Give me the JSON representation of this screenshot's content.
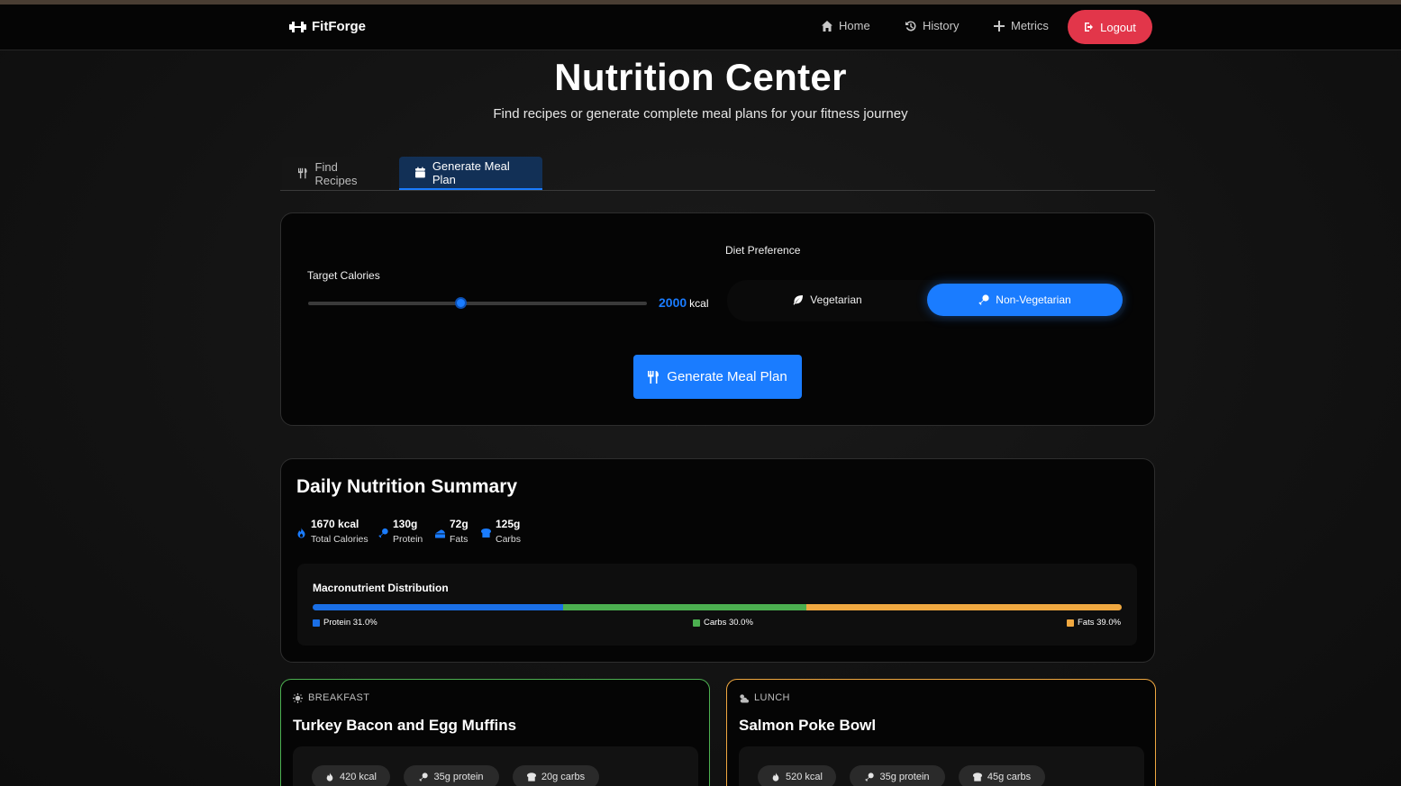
{
  "app": {
    "brand": "FitForge"
  },
  "nav": {
    "home": "Home",
    "history": "History",
    "metrics": "Metrics",
    "logout": "Logout"
  },
  "page": {
    "title": "Nutrition Center",
    "subtitle": "Find recipes or generate complete meal plans for your fitness journey"
  },
  "tabs": [
    {
      "label": "Find Recipes"
    },
    {
      "label": "Generate Meal Plan",
      "active": true
    }
  ],
  "form": {
    "target_calories_label": "Target Calories",
    "calories_value": "2000",
    "calories_unit": "kcal",
    "calories_slider_fraction": 0.45,
    "diet_label": "Diet Preference",
    "diet_options": [
      "Vegetarian",
      "Non-Vegetarian"
    ],
    "diet_selected": "Non-Vegetarian",
    "generate_label": "Generate Meal Plan"
  },
  "summary": {
    "title": "Daily Nutrition Summary",
    "stats": [
      {
        "value": "1670 kcal",
        "label": "Total Calories",
        "icon": "flame-icon"
      },
      {
        "value": "130g",
        "label": "Protein",
        "icon": "drumstick-icon"
      },
      {
        "value": "72g",
        "label": "Fats",
        "icon": "cheese-icon"
      },
      {
        "value": "125g",
        "label": "Carbs",
        "icon": "bread-icon"
      }
    ],
    "macro_title": "Macronutrient Distribution",
    "macros": [
      {
        "name": "Protein",
        "percent": 31.0,
        "text": "Protein 31.0%",
        "color": "#1a6fe6"
      },
      {
        "name": "Carbs",
        "percent": 30.0,
        "text": "Carbs 30.0%",
        "color": "#4caf50"
      },
      {
        "name": "Fats",
        "percent": 39.0,
        "text": "Fats 39.0%",
        "color": "#f0a840"
      }
    ]
  },
  "meals": [
    {
      "tag": "BREAKFAST",
      "name": "Turkey Bacon and Egg Muffins",
      "kcal": "420 kcal",
      "protein": "35g protein",
      "carbs": "20g carbs",
      "accent": "#4caf50"
    },
    {
      "tag": "LUNCH",
      "name": "Salmon Poke Bowl",
      "kcal": "520 kcal",
      "protein": "35g protein",
      "carbs": "45g carbs",
      "accent": "#f0a840"
    }
  ],
  "colors": {
    "accent": "#1a7cff",
    "logout": "#e2364a",
    "background": "#121212"
  }
}
